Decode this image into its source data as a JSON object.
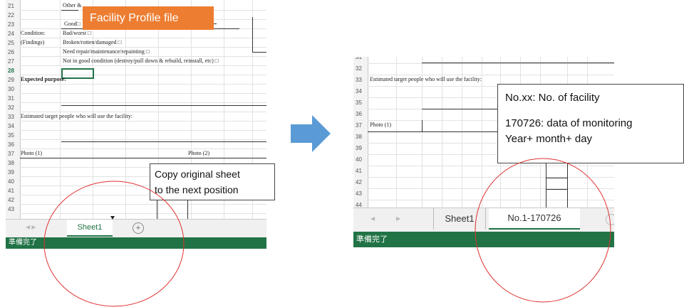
{
  "left_sheet": {
    "rows": [
      "21",
      "22",
      "23",
      "24",
      "25",
      "26",
      "27",
      "28",
      "29",
      "30",
      "31",
      "32",
      "33",
      "34",
      "35",
      "36",
      "37",
      "38",
      "39",
      "40",
      "41",
      "42",
      "43"
    ],
    "active_row": "28",
    "cells": {
      "other": "Other &",
      "good": "Good",
      "condition": "Condition:",
      "findings": "(Findings)",
      "bad": "Bad/worst",
      "broken": "Broken/rotten/damaged",
      "repair": "Need repair/maintenance/repainting",
      "not_good": "Not in good condition (destroy/pull down & rebuild, reinstall, etc)",
      "expected": "Expected purpose:",
      "estimated": "Estimated target people who will use the facility:",
      "photo1": "Photo (1)",
      "photo2": "Photo (2)"
    },
    "checkbox": "□",
    "tab_nav": "◀ ▶",
    "tab_label": "Sheet1",
    "add_tab": "+",
    "status": "準備完了",
    "banner": "Facility Profile file",
    "banner_color": "#ed7d31",
    "callout": [
      "Copy original sheet",
      "to the next position"
    ]
  },
  "arrow_color": "#5b9bd5",
  "right_sheet": {
    "rows": [
      "31",
      "32",
      "33",
      "34",
      "35",
      "36",
      "37",
      "38",
      "39",
      "40",
      "41",
      "42",
      "43",
      "44"
    ],
    "cells": {
      "estimated": "Estimated target people who will use the facility:",
      "photo1": "Photo (1)"
    },
    "tabs": [
      "Sheet1",
      "No.1-170726"
    ],
    "nav_prev": "◀",
    "nav_next": "▶",
    "status": "準備完了",
    "callout": [
      "No.xx: No. of facility",
      "",
      "170726: data of monitoring",
      "Year+ month+ day"
    ]
  },
  "circle_color": "#e03030"
}
